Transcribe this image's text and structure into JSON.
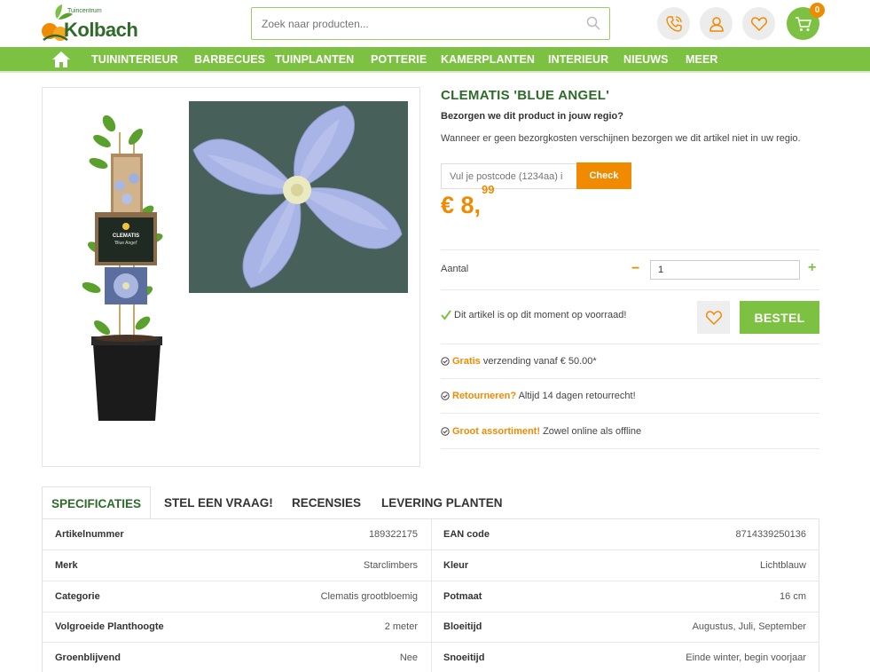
{
  "header": {
    "logo_small": "Tuincentrum",
    "logo_name": "Kolbach",
    "search_placeholder": "Zoek naar producten...",
    "cart_count": "0"
  },
  "nav": {
    "items": [
      "TUININTERIEUR",
      "BARBECUES",
      "TUINPLANTEN",
      "POTTERIE",
      "KAMERPLANTEN",
      "INTERIEUR",
      "NIEUWS",
      "MEER"
    ]
  },
  "product": {
    "title": "CLEMATIS 'BLUE ANGEL'",
    "delivery_question": "Bezorgen we dit product in jouw regio?",
    "delivery_text": "Wanneer er geen bezorgkosten verschijnen bezorgen we dit artikel niet in uw regio.",
    "postcode_placeholder": "Vul je postcode (1234aa) i",
    "check_label": "Check",
    "price_main": "€ 8,",
    "price_cents": "99",
    "qty_label": "Aantal",
    "qty_minus": "−",
    "qty_plus": "+",
    "qty_value": "1",
    "stock_text": "Dit artikel is op dit moment op voorraad!",
    "order_label": "BESTEL",
    "usps": [
      {
        "bold": "Gratis",
        "rest": " verzending vanaf € 50.00*"
      },
      {
        "bold": "Retourneren?",
        "rest": " Altijd 14 dagen retourrecht!"
      },
      {
        "bold": "Groot assortiment!",
        "rest": " Zowel online als offline"
      }
    ],
    "label_name": "CLEMATIS",
    "label_sub": "'Blue Angel'"
  },
  "tabs": [
    "SPECIFICATIES",
    "STEL EEN VRAAG!",
    "RECENSIES",
    "LEVERING PLANTEN"
  ],
  "specs": [
    {
      "k1": "Artikelnummer",
      "v1": "189322175",
      "k2": "EAN code",
      "v2": "8714339250136"
    },
    {
      "k1": "Merk",
      "v1": "Starclimbers",
      "k2": "Kleur",
      "v2": "Lichtblauw"
    },
    {
      "k1": "Categorie",
      "v1": "Clematis grootbloemig",
      "k2": "Potmaat",
      "v2": "16 cm"
    },
    {
      "k1": "Volgroeide Planthoogte",
      "v1": "2 meter",
      "k2": "Bloeitijd",
      "v2": "Augustus, Juli, September"
    },
    {
      "k1": "Groenblijvend",
      "v1": "Nee",
      "k2": "Snoeitijd",
      "v2": "Einde winter, begin voorjaar"
    }
  ],
  "colors": {
    "brand_green": "#7cc142",
    "dark_green": "#2e6b2a",
    "orange": "#f08a00"
  }
}
